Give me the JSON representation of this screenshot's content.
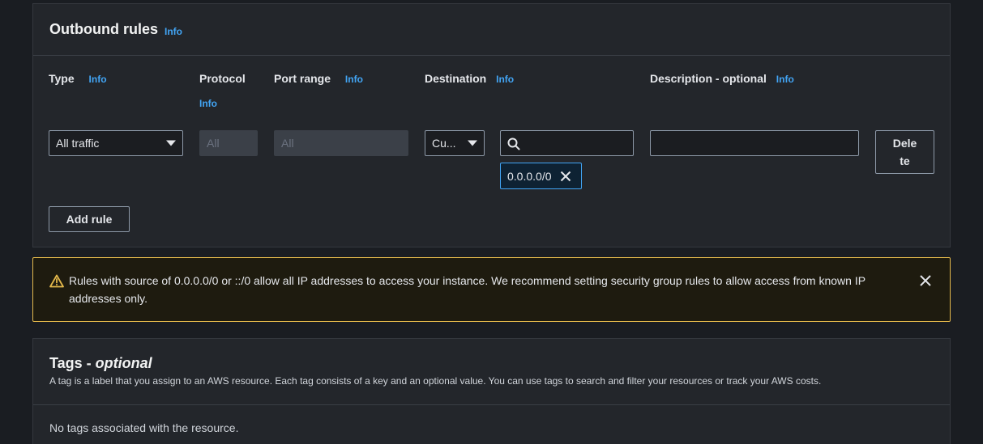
{
  "outbound": {
    "title": "Outbound rules",
    "info": "Info",
    "columns": {
      "type": "Type",
      "protocol": "Protocol",
      "port_range": "Port range",
      "destination": "Destination",
      "description": "Description - optional"
    },
    "rule": {
      "type_value": "All traffic",
      "protocol_value": "All",
      "port_range_value": "All",
      "destination_type_value": "Cu...",
      "destination_search_value": "",
      "destination_token": "0.0.0.0/0",
      "description_value": "",
      "delete_label_line1": "Dele",
      "delete_label_line2": "te"
    },
    "add_rule_label": "Add rule"
  },
  "warning": {
    "text": "Rules with source of 0.0.0.0/0 or ::/0 allow all IP addresses to access your instance. We recommend setting security group rules to allow access from known IP addresses only."
  },
  "tags": {
    "title_main": "Tags - ",
    "title_optional": "optional",
    "description": "A tag is a label that you assign to an AWS resource. Each tag consists of a key and an optional value. You can use tags to search and filter your resources or track your AWS costs.",
    "empty_message": "No tags associated with the resource."
  },
  "colors": {
    "background": "#1a1d22",
    "panel": "#23262b",
    "info_link": "#42a5f5",
    "warning_border": "#e4b94b"
  }
}
